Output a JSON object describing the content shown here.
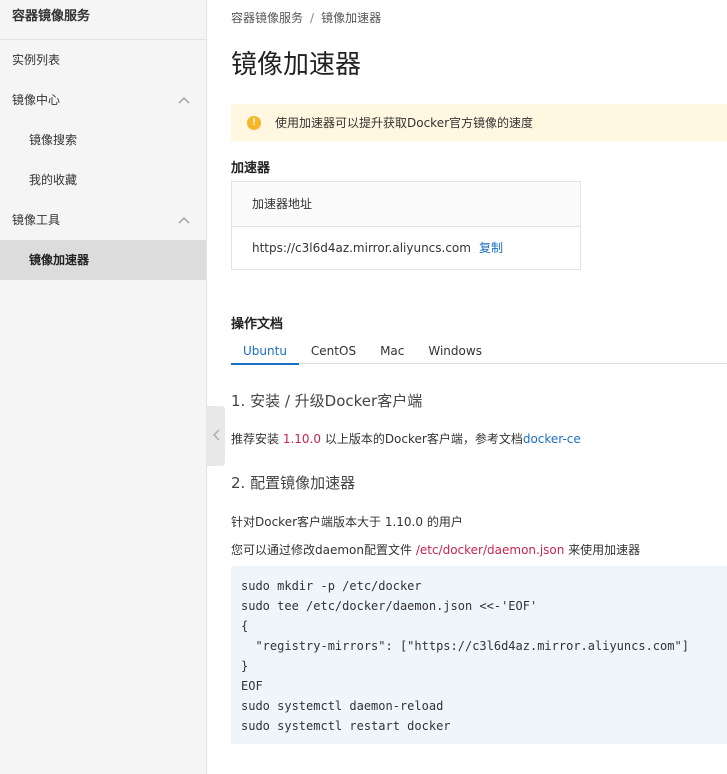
{
  "sidebar": {
    "title": "容器镜像服务",
    "items": [
      {
        "label": "实例列表"
      },
      {
        "label": "镜像中心"
      },
      {
        "label": "镜像搜索"
      },
      {
        "label": "我的收藏"
      },
      {
        "label": "镜像工具"
      },
      {
        "label": "镜像加速器"
      }
    ]
  },
  "breadcrumb": {
    "parent": "容器镜像服务",
    "separator": "/",
    "current": "镜像加速器"
  },
  "page_title": "镜像加速器",
  "alert": {
    "icon": "!",
    "text": "使用加速器可以提升获取Docker官方镜像的速度"
  },
  "accelerator": {
    "heading": "加速器",
    "column_header": "加速器地址",
    "address": "https://c3l6d4az.mirror.aliyuncs.com",
    "copy_label": "复制"
  },
  "docs": {
    "heading": "操作文档",
    "tabs": [
      "Ubuntu",
      "CentOS",
      "Mac",
      "Windows"
    ],
    "active_tab": "Ubuntu",
    "step1": {
      "title": "1. 安装 / 升级Docker客户端",
      "text_before": "推荐安装 ",
      "version": "1.10.0",
      "text_after": " 以上版本的Docker客户端，参考文档",
      "link": "docker-ce"
    },
    "step2": {
      "title": "2. 配置镜像加速器",
      "line1": "针对Docker客户端版本大于 1.10.0 的用户",
      "line2_before": "您可以通过修改daemon配置文件 ",
      "config_path": "/etc/docker/daemon.json",
      "line2_after": " 来使用加速器"
    },
    "code": [
      "sudo mkdir -p /etc/docker",
      "sudo tee /etc/docker/daemon.json <<-'EOF'",
      "{",
      "  \"registry-mirrors\": [\"https://c3l6d4az.mirror.aliyuncs.com\"]",
      "}",
      "EOF",
      "sudo systemctl daemon-reload",
      "sudo systemctl restart docker"
    ]
  },
  "colors": {
    "accent": "#1a6fc4",
    "alert_bg": "#fff7e0",
    "alert_icon": "#f5b72a",
    "code_bg": "#eef5fb",
    "highlight_red": "#c7254e"
  },
  "icons": {
    "menu_expand": "chevron-up-icon",
    "collapse_handle": "chevron-left-icon",
    "alert": "warning-icon"
  }
}
